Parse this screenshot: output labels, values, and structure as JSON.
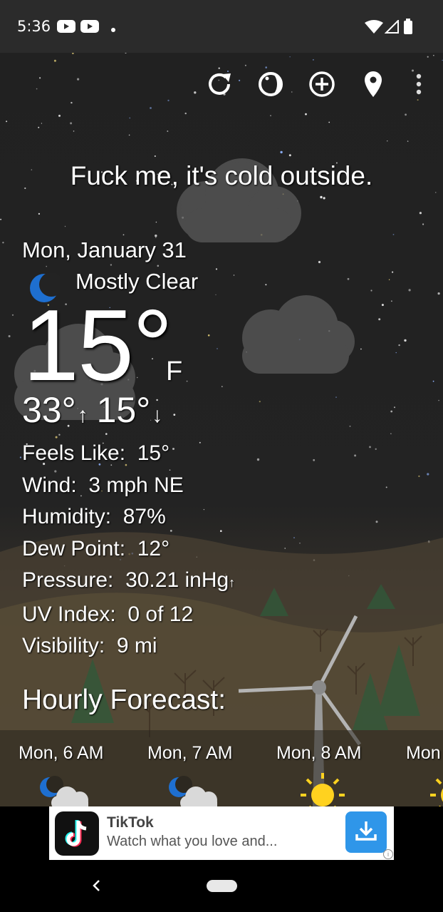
{
  "status_bar": {
    "time": "5:36",
    "icons": [
      "youtube-icon",
      "youtube-icon",
      "dot-icon",
      "wifi-icon",
      "signal-icon",
      "battery-icon"
    ]
  },
  "toolbar": {
    "icons": [
      "refresh-icon",
      "theme-icon",
      "add-location-icon",
      "location-pin-icon",
      "more-vert-icon"
    ]
  },
  "main": {
    "headline": "Fuck me, it's cold outside.",
    "date": "Mon, January 31",
    "condition": "Mostly Clear",
    "condition_icon": "crescent-moon-icon",
    "temperature": "15°",
    "unit": "F",
    "high": "33°",
    "low": "15°",
    "details": [
      {
        "label": "Feels Like:",
        "value": "15°"
      },
      {
        "label": "Wind:",
        "value": "3 mph NE"
      },
      {
        "label": "Humidity:",
        "value": "87%"
      },
      {
        "label": "Dew Point:",
        "value": "12°"
      },
      {
        "label": "Pressure:",
        "value": "30.21 inHg",
        "trend": "↑"
      },
      {
        "label": "UV Index:",
        "value": "0 of 12"
      },
      {
        "label": "Visibility:",
        "value": "9 mi"
      }
    ]
  },
  "hourly": {
    "title": "Hourly Forecast:",
    "items": [
      {
        "label": "Mon, 6 AM",
        "icon": "moon-cloud-icon"
      },
      {
        "label": "Mon, 7 AM",
        "icon": "moon-cloud-icon"
      },
      {
        "label": "Mon, 8 AM",
        "icon": "sun-icon"
      },
      {
        "label": "Mon",
        "icon": "sun-icon"
      }
    ]
  },
  "ad": {
    "title": "TikTok",
    "subtitle": "Watch what you love and...",
    "logo": "tiktok-logo-icon",
    "action_icon": "download-icon"
  },
  "colors": {
    "moon": "#1e6fd0",
    "sun": "#ffd21f",
    "ad_button": "#2f96e9",
    "status_bar": "#2b2b2b"
  }
}
